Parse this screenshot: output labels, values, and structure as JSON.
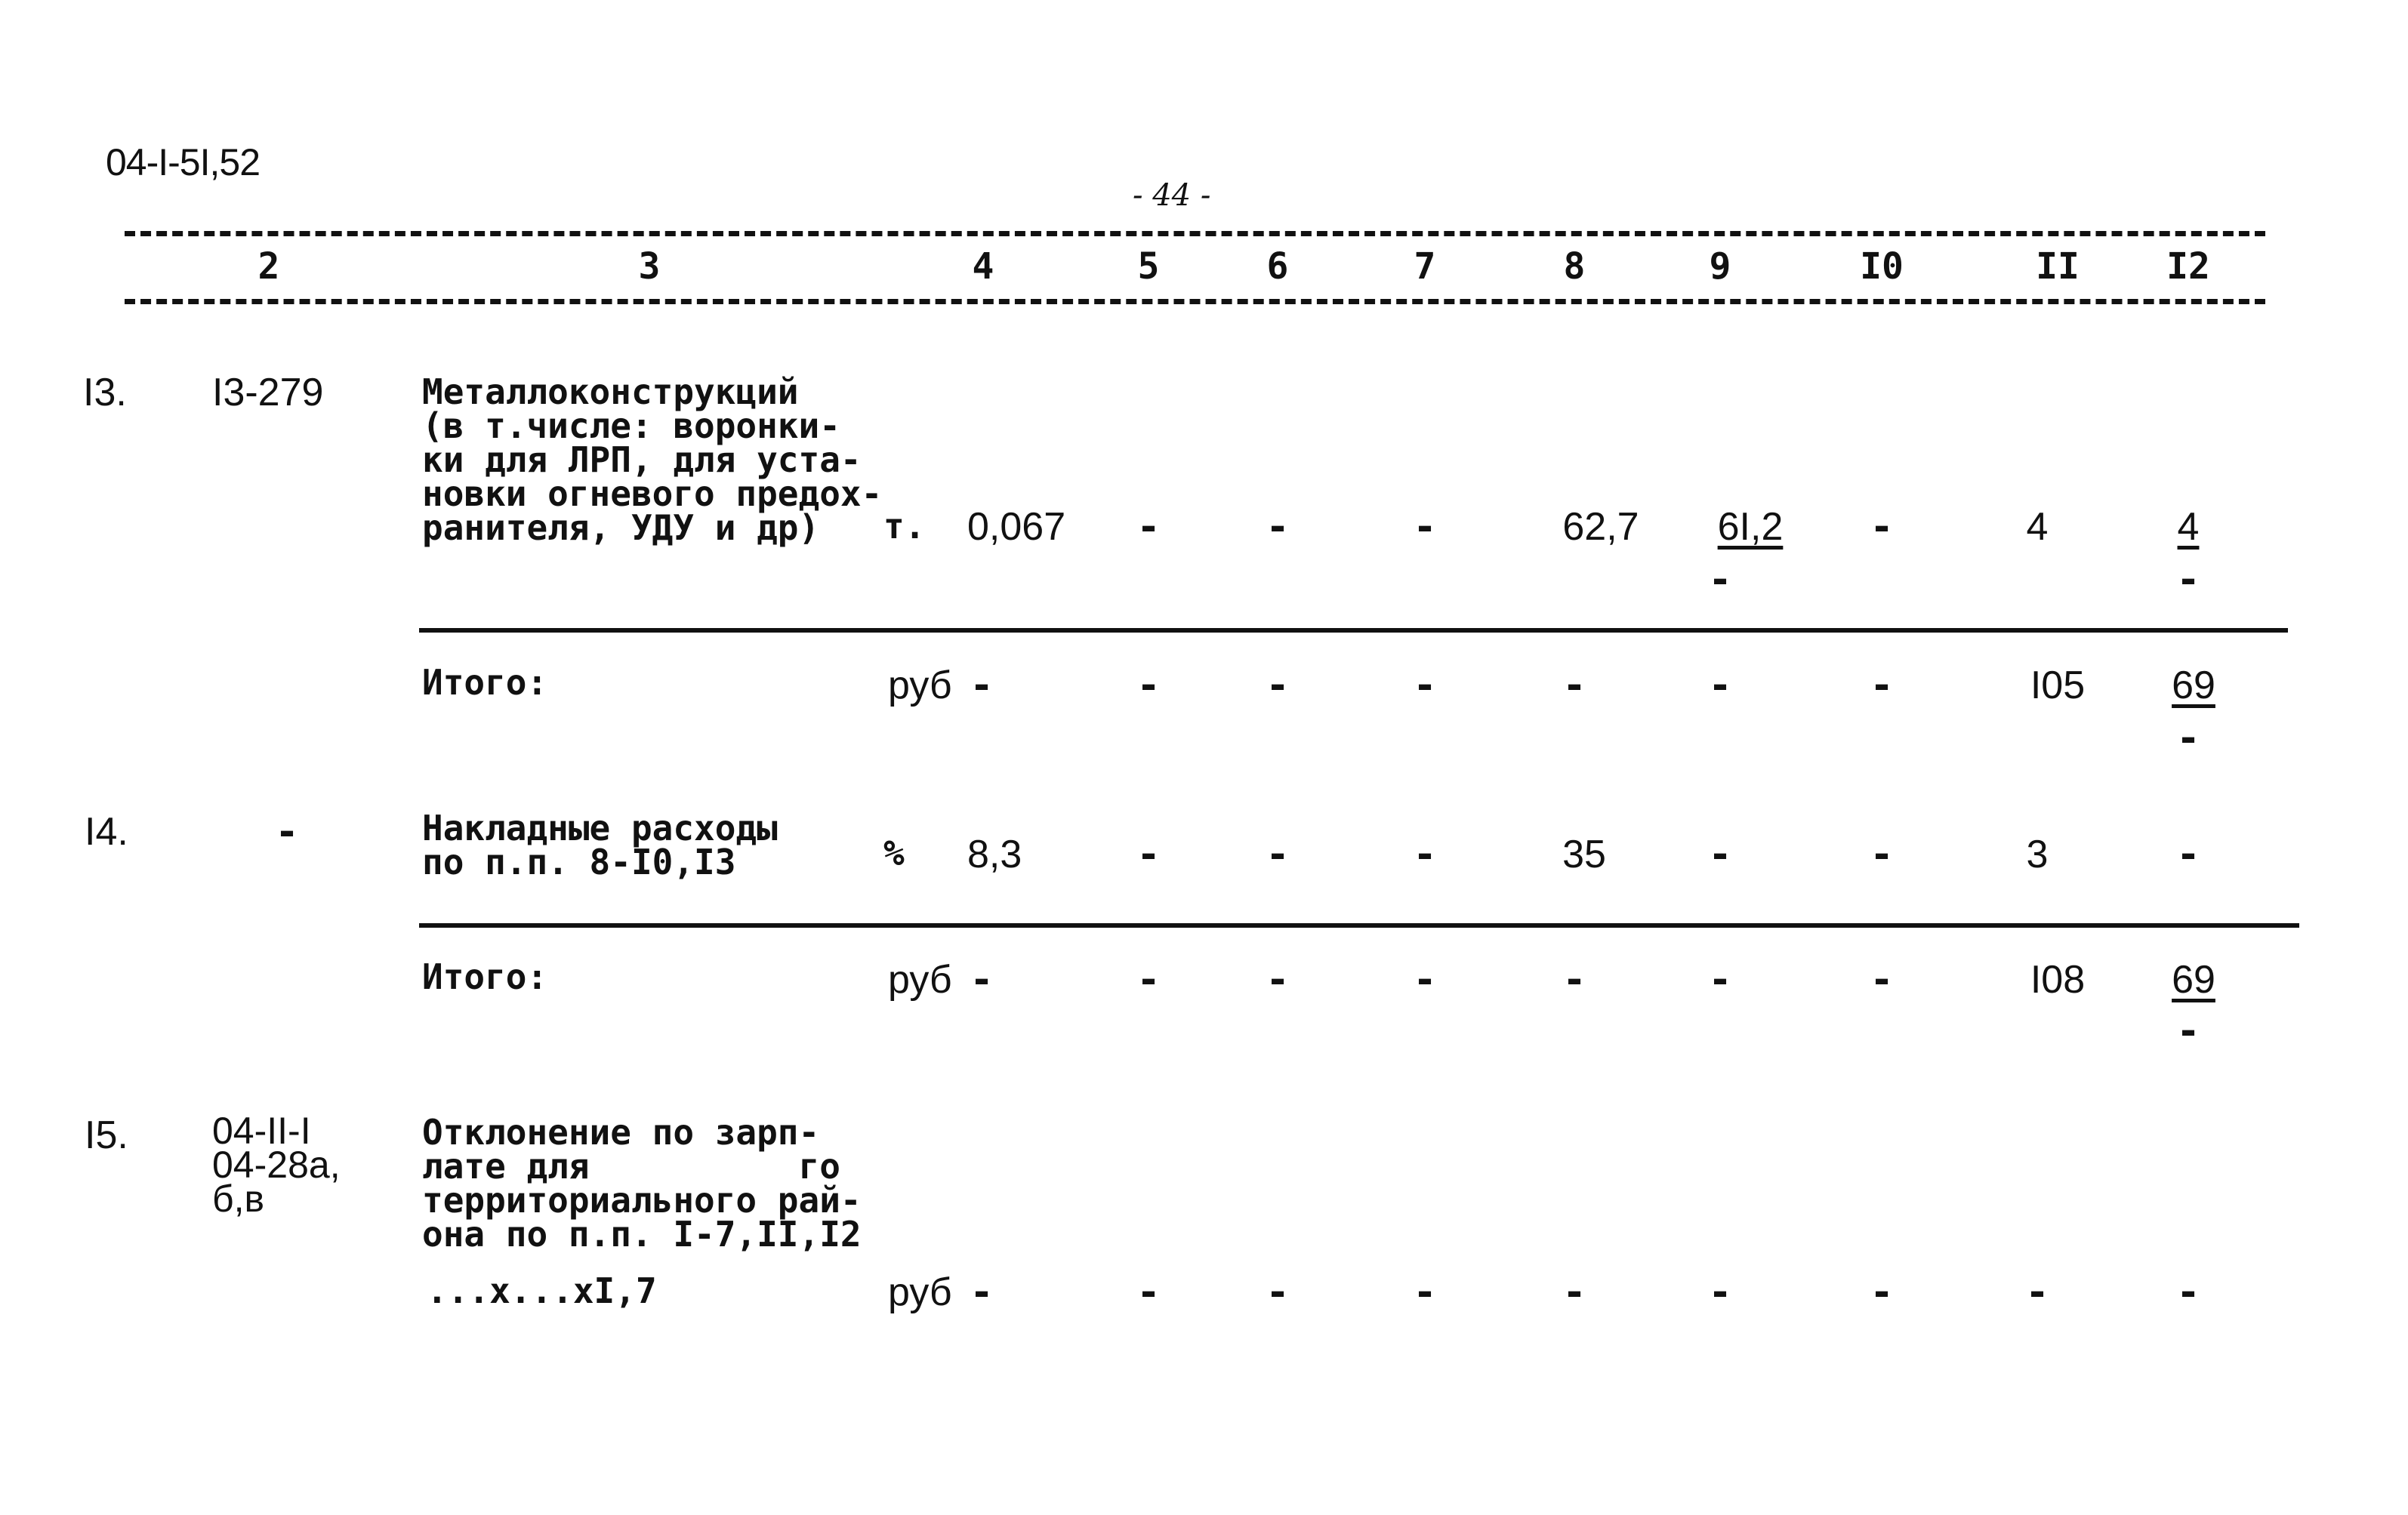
{
  "document": {
    "code": "04-I-5I,52",
    "page_number": "- 44 -"
  },
  "table": {
    "column_headers": [
      "2",
      "3",
      "4",
      "5",
      "6",
      "7",
      "8",
      "9",
      "I0",
      "II",
      "I2"
    ],
    "rows": [
      {
        "num": "I3.",
        "code": "I3-279",
        "description_lines": [
          "Металлоконструкций",
          "(в т.числе: воронки-",
          "ки для ЛРП, для уста-",
          "новки огневого предох-",
          "ранителя, УДУ и др)"
        ],
        "unit": "т.",
        "col4": "0,067",
        "col5": "-",
        "col6": "-",
        "col7": "-",
        "col8": "62,7",
        "col9": "6I,2",
        "col9_below": "-",
        "col10": "-",
        "col11": "4",
        "col12": "4",
        "col12_below": "-"
      },
      {
        "label": "Итого:",
        "unit": "руб",
        "col4": "-",
        "col5": "-",
        "col6": "-",
        "col7": "-",
        "col8": "-",
        "col9": "-",
        "col10": "-",
        "col11": "I05",
        "col12": "69",
        "col12_below": "-"
      },
      {
        "num": "I4.",
        "code": "-",
        "description_lines": [
          "Накладные расходы",
          "по п.п. 8-I0,I3"
        ],
        "unit": "%",
        "col4": "8,3",
        "col5": "-",
        "col6": "-",
        "col7": "-",
        "col8": "35",
        "col9": "-",
        "col10": "-",
        "col11": "3",
        "col12": "-"
      },
      {
        "label": "Итого:",
        "unit": "руб",
        "col4": "-",
        "col5": "-",
        "col6": "-",
        "col7": "-",
        "col8": "-",
        "col9": "-",
        "col10": "-",
        "col11": "I08",
        "col12": "69",
        "col12_below": "-"
      },
      {
        "num": "I5.",
        "code_lines": [
          "04-II-I",
          "04-28а,",
          "б,в"
        ],
        "description_lines": [
          "Отклонение по зарп-",
          "лате для          го",
          "территориального рай-",
          "она по п.п. I-7,II,I2"
        ],
        "formula": "...х...хI,7",
        "unit": "руб",
        "col4": "-",
        "col5": "-",
        "col6": "-",
        "col7": "-",
        "col8": "-",
        "col9": "-",
        "col10": "-",
        "col11": "-",
        "col12": "-"
      }
    ]
  }
}
